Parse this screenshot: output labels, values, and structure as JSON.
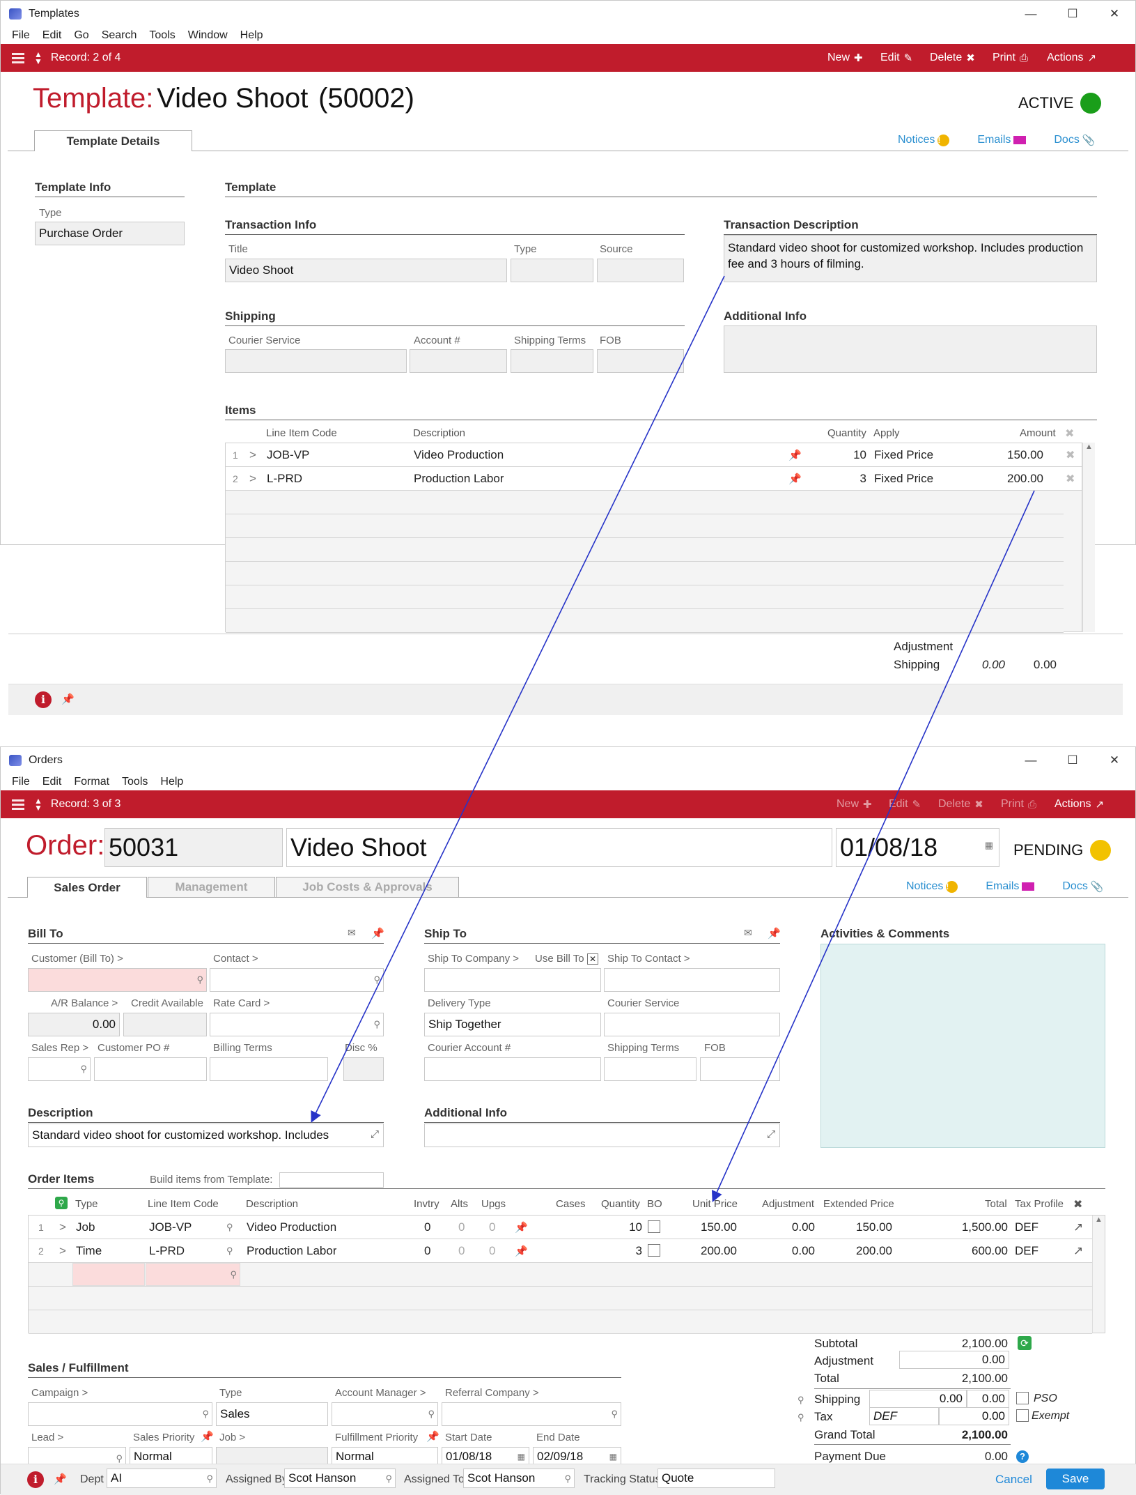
{
  "templates_window": {
    "title": "Templates",
    "menu": [
      "File",
      "Edit",
      "Go",
      "Search",
      "Tools",
      "Window",
      "Help"
    ],
    "record": "Record: 2 of 4",
    "toolbar": {
      "new": "New",
      "edit": "Edit",
      "delete": "Delete",
      "print": "Print",
      "actions": "Actions"
    },
    "header": {
      "label": "Template:",
      "name": "Video Shoot",
      "id": "(50002)",
      "status": "ACTIVE",
      "status_color": "#1a9e1a"
    },
    "tabs": [
      "Template Details"
    ],
    "links": {
      "notices": "Notices",
      "emails": "Emails",
      "docs": "Docs"
    },
    "template_info": {
      "section": "Template Info",
      "type_label": "Type",
      "type_value": "Purchase Order"
    },
    "template_section": "Template",
    "transaction_info": {
      "section": "Transaction Info",
      "title_label": "Title",
      "title_value": "Video Shoot",
      "type_label": "Type",
      "source_label": "Source"
    },
    "transaction_description": {
      "section": "Transaction Description",
      "value": "Standard video shoot for customized workshop. Includes production fee and 3 hours of filming."
    },
    "shipping": {
      "section": "Shipping",
      "courier_label": "Courier Service",
      "account_label": "Account #",
      "terms_label": "Shipping Terms",
      "fob_label": "FOB"
    },
    "additional_info": {
      "section": "Additional Info"
    },
    "items": {
      "section": "Items",
      "headers": {
        "code": "Line Item Code",
        "desc": "Description",
        "qty": "Quantity",
        "apply": "Apply",
        "amount": "Amount"
      },
      "rows": [
        {
          "n": "1",
          "code": "JOB-VP",
          "desc": "Video Production",
          "qty": "10",
          "apply": "Fixed Price",
          "amount": "150.00"
        },
        {
          "n": "2",
          "code": "L-PRD",
          "desc": "Production Labor",
          "qty": "3",
          "apply": "Fixed Price",
          "amount": "200.00"
        }
      ]
    },
    "footer": {
      "adjustment_label": "Adjustment",
      "shipping_label": "Shipping",
      "shipping_italic": "0.00",
      "shipping_value": "0.00"
    }
  },
  "orders_window": {
    "title": "Orders",
    "menu": [
      "File",
      "Edit",
      "Format",
      "Tools",
      "Help"
    ],
    "record": "Record: 3 of 3",
    "toolbar": {
      "new": "New",
      "edit": "Edit",
      "delete": "Delete",
      "print": "Print",
      "actions": "Actions"
    },
    "header": {
      "label": "Order:",
      "number": "50031",
      "name": "Video Shoot",
      "date": "01/08/18",
      "status": "PENDING",
      "status_color": "#f2c200"
    },
    "tabs": [
      "Sales Order",
      "Management",
      "Job Costs & Approvals"
    ],
    "links": {
      "notices": "Notices",
      "emails": "Emails",
      "docs": "Docs"
    },
    "bill_to": {
      "section": "Bill To",
      "customer_label": "Customer (Bill To) >",
      "contact_label": "Contact >",
      "ar_label": "A/R Balance >",
      "ar_value": "0.00",
      "credit_label": "Credit Available",
      "rate_label": "Rate Card >",
      "sales_rep_label": "Sales Rep >",
      "customer_po_label": "Customer PO #",
      "billing_terms_label": "Billing Terms",
      "disc_label": "Disc %"
    },
    "ship_to": {
      "section": "Ship To",
      "company_label": "Ship To Company >",
      "use_bill_label": "Use Bill To",
      "contact_label": "Ship To Contact >",
      "delivery_label": "Delivery Type",
      "delivery_value": "Ship Together",
      "courier_label": "Courier Service",
      "courier_acct_label": "Courier Account #",
      "terms_label": "Shipping Terms",
      "fob_label": "FOB"
    },
    "activities": {
      "section": "Activities & Comments"
    },
    "description": {
      "section": "Description",
      "value": "Standard video shoot for customized workshop. Includes"
    },
    "additional_info": {
      "section": "Additional Info"
    },
    "order_items": {
      "section": "Order Items",
      "build_label": "Build items from Template:",
      "headers": {
        "type": "Type",
        "code": "Line Item Code",
        "desc": "Description",
        "invtry": "Invtry",
        "alts": "Alts",
        "upgs": "Upgs",
        "cases": "Cases",
        "qty": "Quantity",
        "bo": "BO",
        "unit": "Unit Price",
        "adj": "Adjustment",
        "ext": "Extended Price",
        "total": "Total",
        "tax": "Tax Profile"
      },
      "rows": [
        {
          "n": "1",
          "type": "Job",
          "code": "JOB-VP",
          "desc": "Video Production",
          "invtry": "0",
          "alts": "0",
          "upgs": "0",
          "qty": "10",
          "unit": "150.00",
          "adj": "0.00",
          "ext": "150.00",
          "total": "1,500.00",
          "tax": "DEF"
        },
        {
          "n": "2",
          "type": "Time",
          "code": "L-PRD",
          "desc": "Production Labor",
          "invtry": "0",
          "alts": "0",
          "upgs": "0",
          "qty": "3",
          "unit": "200.00",
          "adj": "0.00",
          "ext": "200.00",
          "total": "600.00",
          "tax": "DEF"
        }
      ]
    },
    "sales": {
      "section": "Sales / Fulfillment",
      "campaign_label": "Campaign >",
      "type_label": "Type",
      "type_value": "Sales",
      "account_manager_label": "Account Manager >",
      "referral_label": "Referral Company >",
      "lead_label": "Lead >",
      "priority_label": "Sales Priority",
      "priority_value": "Normal",
      "job_label": "Job >",
      "fulfillment_label": "Fulfillment Priority",
      "fulfillment_value": "Normal",
      "start_label": "Start Date",
      "start_value": "01/08/18",
      "end_label": "End Date",
      "end_value": "02/09/18"
    },
    "totals": {
      "subtotal_label": "Subtotal",
      "subtotal": "2,100.00",
      "adjustment_label": "Adjustment",
      "adjustment": "0.00",
      "total_label": "Total",
      "total": "2,100.00",
      "shipping_label": "Shipping",
      "shipping_a": "0.00",
      "shipping_b": "0.00",
      "pso_label": "PSO",
      "tax_label": "Tax",
      "tax_profile": "DEF",
      "tax_value": "0.00",
      "exempt_label": "Exempt",
      "grand_label": "Grand Total",
      "grand": "2,100.00",
      "payment_label": "Payment Due",
      "payment": "0.00"
    },
    "bottom": {
      "dept_label": "Dept",
      "dept_value": "AI",
      "assigned_by_label": "Assigned By",
      "assigned_by_value": "Scot Hanson",
      "assigned_to_label": "Assigned To",
      "assigned_to_value": "Scot Hanson",
      "tracking_label": "Tracking Status",
      "tracking_value": "Quote",
      "cancel": "Cancel",
      "save": "Save"
    }
  }
}
